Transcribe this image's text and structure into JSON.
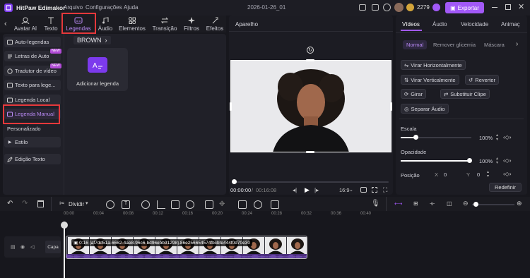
{
  "app": {
    "title": "HitPaw Edimakor",
    "menu": [
      "Arquivo",
      "Configurações",
      "Ajuda"
    ],
    "project": "2026-01-26_01",
    "credits": "2279",
    "export_label": "Exportar"
  },
  "tools": [
    {
      "label": "Avatar AI"
    },
    {
      "label": "Texto"
    },
    {
      "label": "Legendas"
    },
    {
      "label": "Áudio"
    },
    {
      "label": "Elementos"
    },
    {
      "label": "Transição"
    },
    {
      "label": "Filtros"
    },
    {
      "label": "Efeitos"
    }
  ],
  "sidebar": {
    "items": [
      {
        "label": "Auto-legendas",
        "badge": ""
      },
      {
        "label": "Letras de Auto",
        "badge": "NEW"
      },
      {
        "label": "Tradutor de vídeo",
        "badge": "NEW"
      },
      {
        "label": "Texto para lege..."
      },
      {
        "label": "Legenda Local"
      },
      {
        "label": "Legenda Manual"
      },
      {
        "label": "Personalizado"
      },
      {
        "label": "Estilo"
      },
      {
        "label": "Edição Texto"
      }
    ]
  },
  "library": {
    "category": "BROWN",
    "add_label": "Adicionar legenda"
  },
  "player": {
    "title": "Aparelho",
    "time_current": "00:00:00",
    "time_total": "00:16:08",
    "aspect": "16:9"
  },
  "props": {
    "tabs": [
      "Vídeos",
      "Áudio",
      "Velocidade",
      "Animaç"
    ],
    "subtabs": [
      "Normal",
      "Remover glicemia",
      "Máscara"
    ],
    "buttons": [
      "Virar Horizontalmente",
      "Virar Verticalmente",
      "Reverter",
      "Girar",
      "Substituir Clipe",
      "Separar Áudio"
    ],
    "scale_label": "Escala",
    "scale_value": "100%",
    "opacity_label": "Opacidade",
    "opacity_value": "100%",
    "position_label": "Posição",
    "pos_x_label": "X",
    "pos_x": "0",
    "pos_y_label": "Y",
    "pos_y": "0",
    "reset_label": "Redefinir"
  },
  "timeline": {
    "split_label": "Dividir",
    "ruler": [
      "00:00",
      "00:04",
      "00:08",
      "00:12",
      "00:16",
      "00:20",
      "00:24",
      "00:28",
      "00:32",
      "00:36",
      "00:40"
    ],
    "track_label": "Capa",
    "clip_label": "0:16 {af7dd51a-6662-4ae8-96c6-bd96ebb91298}.86e256654574fbcbfe444f0d70e30"
  },
  "colors": {
    "accent": "#a259f7",
    "highlight": "#e5383b"
  }
}
